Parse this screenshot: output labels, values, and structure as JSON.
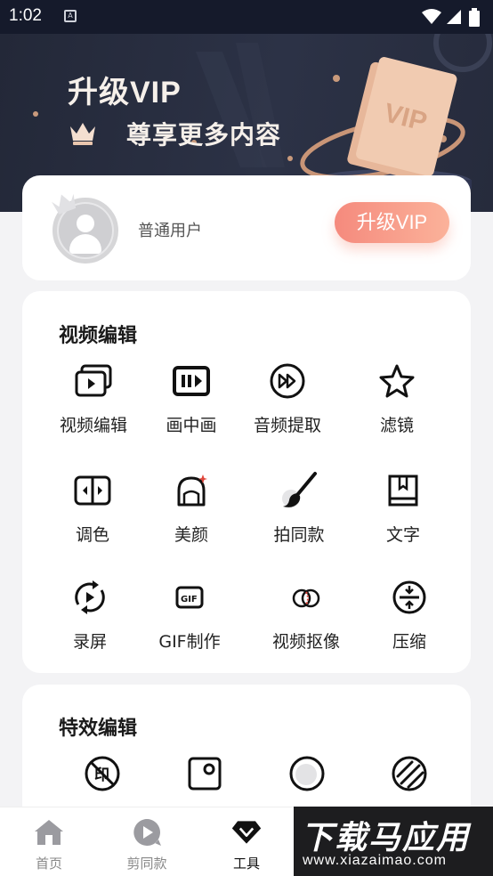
{
  "status_bar": {
    "time": "1:02",
    "notification_glyph": "A"
  },
  "banner": {
    "title": "升级VIP",
    "subtitle": "尊享更多内容",
    "card_text": "VIP"
  },
  "user": {
    "name": "普通用户",
    "upgrade_label": "升级VIP"
  },
  "video_edit": {
    "title": "视频编辑",
    "tools": [
      {
        "label": "视频编辑",
        "icon": "video-edit-icon"
      },
      {
        "label": "画中画",
        "icon": "picture-in-picture-icon"
      },
      {
        "label": "音频提取",
        "icon": "fast-forward-icon"
      },
      {
        "label": "滤镜",
        "icon": "star-icon"
      },
      {
        "label": "调色",
        "icon": "split-adjust-icon"
      },
      {
        "label": "美颜",
        "icon": "beauty-face-icon"
      },
      {
        "label": "拍同款",
        "icon": "paintbrush-icon"
      },
      {
        "label": "文字",
        "icon": "text-book-icon"
      },
      {
        "label": "录屏",
        "icon": "record-rotate-icon"
      },
      {
        "label": "GIF制作",
        "icon": "gif-icon"
      },
      {
        "label": "视频抠像",
        "icon": "overlap-circles-icon"
      },
      {
        "label": "压缩",
        "icon": "compress-icon"
      }
    ]
  },
  "effects_edit": {
    "title": "特效编辑",
    "tools": [
      {
        "label": "",
        "icon": "watermark-remove-icon",
        "glyph": "印"
      },
      {
        "label": "",
        "icon": "photo-frame-icon"
      },
      {
        "label": "",
        "icon": "circle-moon-icon"
      },
      {
        "label": "",
        "icon": "stripe-ball-icon"
      }
    ]
  },
  "tabbar": {
    "tabs": [
      {
        "label": "首页",
        "icon": "home-icon"
      },
      {
        "label": "剪同款",
        "icon": "play-bubble-icon"
      },
      {
        "label": "工具",
        "icon": "diamond-icon"
      }
    ]
  },
  "watermark": {
    "title": "下载马应用",
    "url": "www.xiazaimao.com"
  },
  "colors": {
    "banner_bg": "#262b3c",
    "upgrade_gradient_start": "#f58a7d",
    "upgrade_gradient_end": "#fbb29a",
    "page_bg": "#f3f3f5"
  }
}
